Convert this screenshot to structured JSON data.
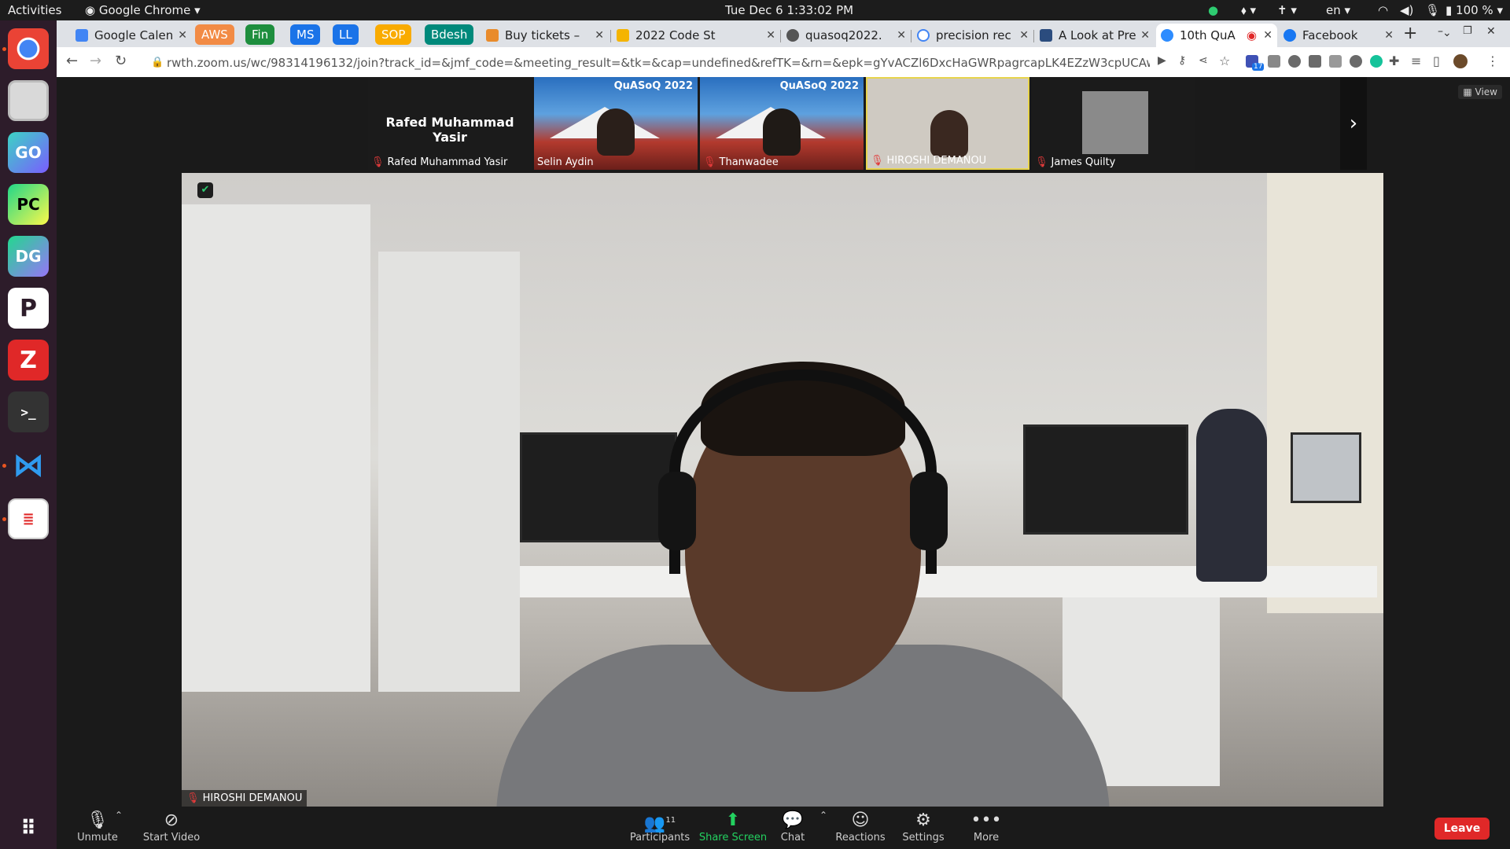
{
  "topbar": {
    "activities": "Activities",
    "app_name": "Google Chrome",
    "datetime": "Tue Dec 6  1:33:02 PM",
    "lang": "en",
    "battery": "100 %"
  },
  "dock": {
    "apps": [
      "chrome-icon",
      "files-icon",
      "goland-icon",
      "pycharm-icon",
      "datagrip-icon",
      "p-app-icon",
      "zotero-icon",
      "terminal-icon",
      "vscode-icon",
      "reader-icon"
    ],
    "labels": {
      "goland": "GO",
      "pycharm": "PC",
      "datagrip": "DG",
      "papp": "P",
      "zotero": "Z",
      "terminal": ">_"
    }
  },
  "browser": {
    "tab_groups": [
      {
        "label": "AWS",
        "color": "#f28b45"
      },
      {
        "label": "Fin",
        "color": "#1e8e3e"
      },
      {
        "label": "MS",
        "color": "#1a73e8"
      },
      {
        "label": "LL",
        "color": "#1a73e8"
      },
      {
        "label": "SOP",
        "color": "#f9ab00"
      },
      {
        "label": "Bdesh",
        "color": "#00897b"
      }
    ],
    "tabs": [
      {
        "title": "Google Calen"
      },
      {
        "title": "Buy tickets – "
      },
      {
        "title": "2022 Code St"
      },
      {
        "title": "quasoq2022."
      },
      {
        "title": "precision rec"
      },
      {
        "title": "A Look at Pre"
      },
      {
        "title": "10th QuA"
      },
      {
        "title": "Facebook"
      }
    ],
    "url": "rwth.zoom.us/wc/98314196132/join?track_id=&jmf_code=&meeting_result=&tk=&cap=undefined&refTK=&rn=&epk=gYvACZl6DxcHaGWRpagrcapLK4EZzW3cpUCAwd6VMGy09OrmJF...",
    "ext_badge": "17"
  },
  "zoom": {
    "gallery": [
      {
        "name": "Rafed Muhammad Yasir",
        "big_name": "Rafed Muhammad Yasir",
        "muted": true
      },
      {
        "name": "Selin Aydin",
        "banner": "QuASoQ 2022",
        "muted": false
      },
      {
        "name": "Thanwadee",
        "banner": "QuASoQ 2022",
        "muted": true
      },
      {
        "name": "HIROSHI DEMANOU",
        "muted": true
      },
      {
        "name": "James Quilty",
        "muted": true
      }
    ],
    "view_label": "View",
    "main_speaker": "HIROSHI DEMANOU",
    "controls": {
      "unmute": "Unmute",
      "start_video": "Start Video",
      "participants": "Participants",
      "participants_count": "11",
      "share_screen": "Share Screen",
      "chat": "Chat",
      "reactions": "Reactions",
      "settings": "Settings",
      "more": "More",
      "leave": "Leave"
    }
  }
}
